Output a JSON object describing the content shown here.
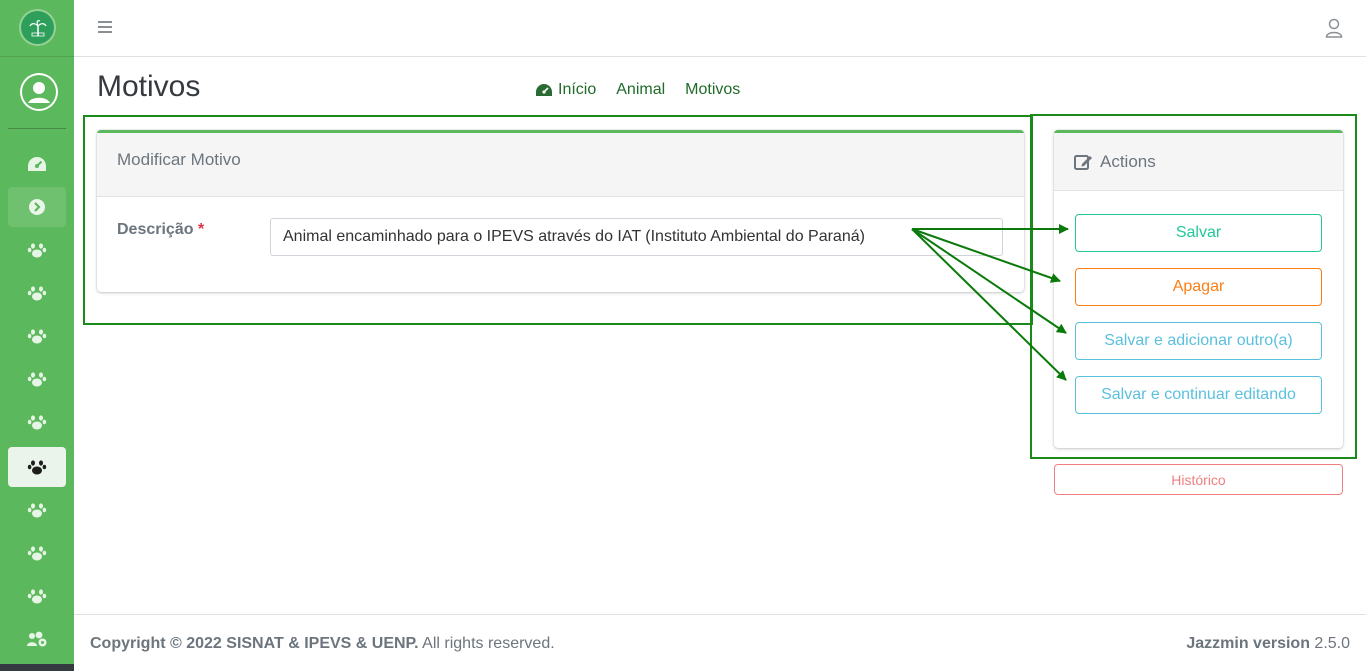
{
  "sidebar": {
    "logo_icon": "palm-tree-logo-icon",
    "user_icon": "user-circle-icon",
    "items": [
      {
        "icon": "dashboard-icon",
        "state": "normal"
      },
      {
        "icon": "chevron-circle-right-icon",
        "state": "hover"
      },
      {
        "icon": "paw-icon",
        "state": "normal"
      },
      {
        "icon": "paw-icon",
        "state": "normal"
      },
      {
        "icon": "paw-icon",
        "state": "normal"
      },
      {
        "icon": "paw-icon",
        "state": "normal"
      },
      {
        "icon": "paw-icon",
        "state": "normal"
      },
      {
        "icon": "paw-icon",
        "state": "active"
      },
      {
        "icon": "paw-icon",
        "state": "normal"
      },
      {
        "icon": "paw-icon",
        "state": "normal"
      },
      {
        "icon": "paw-icon",
        "state": "normal"
      },
      {
        "icon": "users-cog-icon",
        "state": "normal"
      }
    ],
    "color": "#5cb85c"
  },
  "topbar": {
    "menu_icon": "hamburger-icon",
    "account_icon": "user-outline-icon"
  },
  "header": {
    "title": "Motivos",
    "breadcrumb": [
      "Início",
      "Animal",
      "Motivos"
    ]
  },
  "form": {
    "card_title": "Modificar Motivo",
    "field_label": "Descrição",
    "required_mark": "*",
    "field_value": "Animal encaminhado para o IPEVS através do IAT (Instituto Ambiental do Paraná)"
  },
  "actions": {
    "title": "Actions",
    "save": "Salvar",
    "delete": "Apagar",
    "save_add": "Salvar e adicionar outro(a)",
    "save_continue": "Salvar e continuar editando",
    "history": "Histórico"
  },
  "footer": {
    "copyright": "Copyright © 2022 SISNAT & IPEVS & UENP.",
    "rights": " All rights reserved.",
    "version_label": "Jazzmin version",
    "version": " 2.5.0"
  },
  "colors": {
    "accent": "#5cb85c",
    "save": "#20c997",
    "delete": "#fd7e14",
    "info": "#5bc0de",
    "history": "#f08080",
    "annotation": "#1a8a1a"
  }
}
